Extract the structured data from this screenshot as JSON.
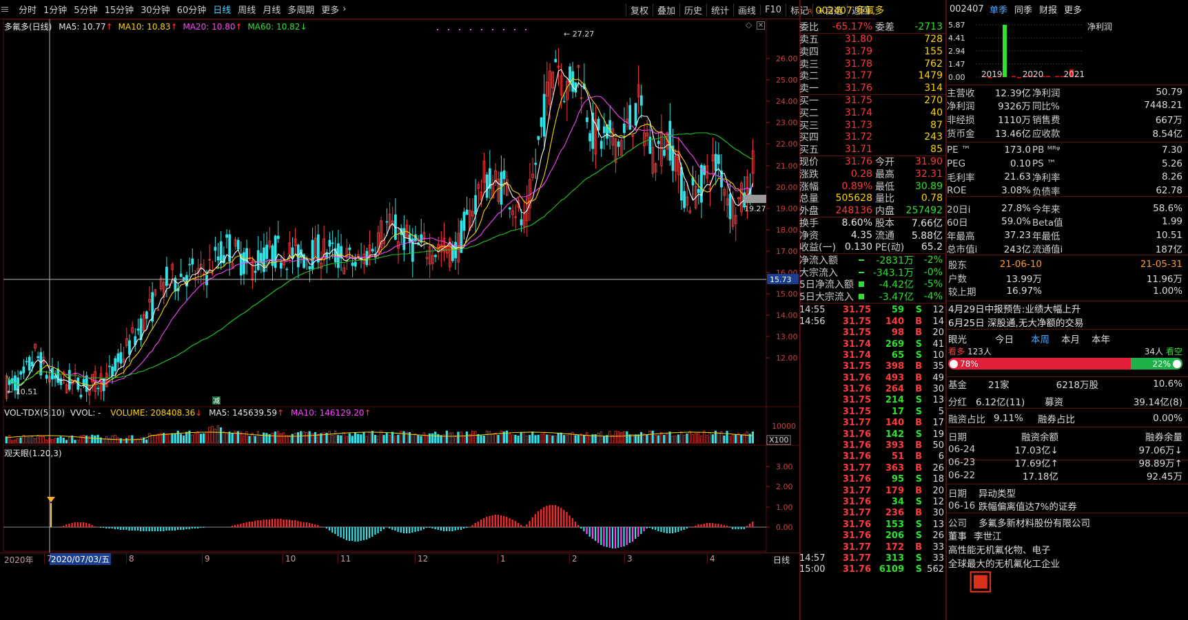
{
  "toolbar": {
    "periods": [
      "分时",
      "1分钟",
      "5分钟",
      "15分钟",
      "30分钟",
      "60分钟",
      "日线",
      "周线",
      "月线",
      "多周期",
      "更多"
    ],
    "active": "日线",
    "right": [
      "复权",
      "叠加",
      "历史",
      "统计",
      "画线",
      "F10",
      "标记",
      "+自选",
      "返回"
    ]
  },
  "main": {
    "title": "多氟多(日线)",
    "ma5": "MA5: 10.77",
    "ma10": "MA10: 10.83",
    "ma20": "MA20: 10.80",
    "ma60": "MA60: 10.82",
    "high_label": "27.27",
    "low_label": "10.51",
    "cur_label": "19.27",
    "cross_price": "15.73",
    "jian": "减",
    "yticks": [
      "26.00",
      "25.00",
      "24.00",
      "23.00",
      "22.00",
      "21.00",
      "20.00",
      "19.00",
      "18.00",
      "17.00",
      "16.00",
      "15.00",
      "14.00",
      "13.00",
      "12.00"
    ]
  },
  "vol": {
    "title": "VOL-TDX(5,10)",
    "vvol": "VVOL: -",
    "volume": "VOLUME: 208408.36",
    "ma5": "MA5: 145639.59",
    "ma10": "MA10: 146129.20",
    "ytick": "10000",
    "unit": "X100"
  },
  "ind": {
    "title": "观天眼(1.20,3)",
    "yticks": [
      "3.00",
      "2.00",
      "1.00",
      "0.00"
    ]
  },
  "timeaxis": {
    "year": "2020年",
    "cur": "2020/07/03/五",
    "months": [
      "7",
      "8",
      "9",
      "10",
      "11",
      "12",
      "1",
      "2",
      "3",
      "4"
    ],
    "right": "日线"
  },
  "quote": {
    "code": "002407",
    "name": "多氟多",
    "webi": {
      "label": "委比",
      "v1": "-65.17%",
      "l2": "委差",
      "v2": "-2713"
    },
    "sells": [
      {
        "l": "卖五",
        "p": "31.80",
        "v": "728"
      },
      {
        "l": "卖四",
        "p": "31.79",
        "v": "155"
      },
      {
        "l": "卖三",
        "p": "31.78",
        "v": "762"
      },
      {
        "l": "卖二",
        "p": "31.77",
        "v": "1479"
      },
      {
        "l": "卖一",
        "p": "31.76",
        "v": "314"
      }
    ],
    "buys": [
      {
        "l": "买一",
        "p": "31.75",
        "v": "270"
      },
      {
        "l": "买二",
        "p": "31.74",
        "v": "40"
      },
      {
        "l": "买三",
        "p": "31.73",
        "v": "87"
      },
      {
        "l": "买四",
        "p": "31.72",
        "v": "243"
      },
      {
        "l": "买五",
        "p": "31.71",
        "v": "85"
      }
    ],
    "stats": [
      [
        "现价",
        "31.76",
        "今开",
        "31.90"
      ],
      [
        "涨跌",
        "0.28",
        "最高",
        "32.31"
      ],
      [
        "涨幅",
        "0.89%",
        "最低",
        "30.89"
      ],
      [
        "总量",
        "505628",
        "量比",
        "0.78"
      ],
      [
        "外盘",
        "248136",
        "内盘",
        "257492"
      ]
    ],
    "stats2": [
      [
        "换手",
        "8.60%",
        "股本",
        "7.66亿"
      ],
      [
        "净资",
        "4.35",
        "流通",
        "5.88亿"
      ],
      [
        "收益(一)",
        "0.130",
        "PE(动)",
        "65.2"
      ]
    ],
    "flows": [
      [
        "净流入额",
        "-2831万",
        "-2%"
      ],
      [
        "大宗流入",
        "-343.1万",
        "-0%"
      ],
      [
        "5日净流入额",
        "-4.42亿",
        "-5%"
      ],
      [
        "5日大宗流入",
        "-3.47亿",
        "-4%"
      ]
    ],
    "ticks": [
      [
        "14:55",
        "31.75",
        "59",
        "S",
        "12"
      ],
      [
        "14:56",
        "31.75",
        "140",
        "B",
        "14"
      ],
      [
        "",
        "31.75",
        "98",
        "B",
        "20"
      ],
      [
        "",
        "31.74",
        "269",
        "S",
        "41"
      ],
      [
        "",
        "31.74",
        "65",
        "S",
        "10"
      ],
      [
        "",
        "31.75",
        "398",
        "B",
        "35"
      ],
      [
        "",
        "31.76",
        "493",
        "B",
        "49"
      ],
      [
        "",
        "31.76",
        "264",
        "B",
        "30"
      ],
      [
        "",
        "31.75",
        "214",
        "S",
        "13"
      ],
      [
        "",
        "31.75",
        "17",
        "S",
        "5"
      ],
      [
        "",
        "31.77",
        "140",
        "B",
        "17"
      ],
      [
        "",
        "31.76",
        "142",
        "S",
        "19"
      ],
      [
        "",
        "31.76",
        "393",
        "B",
        "50"
      ],
      [
        "",
        "31.76",
        "51",
        "B",
        "6"
      ],
      [
        "",
        "31.77",
        "363",
        "B",
        "26"
      ],
      [
        "",
        "31.76",
        "95",
        "S",
        "18"
      ],
      [
        "",
        "31.77",
        "179",
        "B",
        "20"
      ],
      [
        "",
        "31.76",
        "34",
        "S",
        "12"
      ],
      [
        "",
        "31.77",
        "236",
        "B",
        "30"
      ],
      [
        "",
        "31.76",
        "153",
        "S",
        "13"
      ],
      [
        "",
        "31.76",
        "206",
        "S",
        "26"
      ],
      [
        "",
        "31.77",
        "172",
        "B",
        "33"
      ],
      [
        "14:57",
        "31.77",
        "313",
        "S",
        "33"
      ],
      [
        "15:00",
        "31.76",
        "6109",
        "S",
        "562"
      ]
    ]
  },
  "fin": {
    "code": "002407",
    "tabs": [
      "单季",
      "同季",
      "财报",
      "更多"
    ],
    "netprofit": "净利润",
    "yaxis": [
      "5.87",
      "4.41",
      "2.94",
      "1.47",
      "0.00"
    ],
    "years": [
      "2019",
      "2020",
      "2021"
    ],
    "bars": [
      [
        0.02,
        -0.02
      ],
      [
        0.01,
        5.87
      ],
      [
        0.03,
        -0.01
      ],
      [
        0.07,
        0.09
      ],
      [
        0.02,
        0.03
      ],
      [
        0.05,
        0.03
      ],
      [
        0.85,
        0.0
      ]
    ],
    "rows": [
      [
        "主营收",
        "12.39亿",
        "净利润",
        "50.79"
      ],
      [
        "净利润",
        "9326万",
        "同比%",
        "7448.21"
      ],
      [
        "非经损",
        "1110万",
        "销售费",
        "667万"
      ],
      [
        "货币金",
        "13.46亿",
        "应收款",
        "8.54亿"
      ],
      [
        "PE ™",
        "173.0",
        "PB ᴹᴿᵠ",
        "7.30"
      ],
      [
        "PEG",
        "0.10",
        "PS ™",
        "5.26"
      ],
      [
        "毛利率",
        "21.63",
        "净利率",
        "8.26"
      ],
      [
        "ROE",
        "3.08%",
        "负债率",
        "62.78"
      ],
      [
        "20日i",
        "27.8%",
        "今年来",
        "58.6%"
      ],
      [
        "60日",
        "59.0%",
        "Beta值",
        "1.99"
      ],
      [
        "年最高",
        "37.23",
        "年最低",
        "10.51"
      ],
      [
        "总市值i",
        "243亿",
        "流通值i",
        "187亿"
      ]
    ],
    "holders": {
      "label": "股东",
      "d1": "21-06-10",
      "d2": "21-05-31",
      "rows": [
        [
          "户数",
          "13.99万",
          "11.96万"
        ],
        [
          "较上期",
          "16.97%",
          "1.00%"
        ]
      ]
    },
    "news": [
      "4月29日中报预告:业绩大幅上升",
      "6月25日 深股通,无大净额的交易"
    ],
    "eye": {
      "label": "眼光",
      "tabs": [
        "今日",
        "本周",
        "本月",
        "本年"
      ],
      "bull": "看多",
      "bull_n": "123人",
      "bear": "看空",
      "bear_n": "34人",
      "bull_pct": "78%",
      "bear_pct": "22%",
      "bull_frac": 0.78
    },
    "fund": [
      "基金",
      "21家",
      "6218万股",
      "10.6%"
    ],
    "split": [
      "分红",
      "6.12亿(11)",
      "募资",
      "39.14亿(8)"
    ],
    "margin": [
      "融资占比",
      "9.11%",
      "融券占比",
      "0.00%"
    ],
    "mhdr": [
      "日期",
      "融资余额",
      "融券余量"
    ],
    "mrows": [
      [
        "06-24",
        "17.03亿↓",
        "97.06万↓"
      ],
      [
        "06-23",
        "17.69亿↑",
        "98.89万↑"
      ],
      [
        "06-22",
        "17.18亿",
        "92.45万"
      ]
    ],
    "ahdr": [
      "日期",
      "异动类型"
    ],
    "arow": [
      "06-16",
      "跌幅偏离值达7%的证券"
    ],
    "company": [
      "公司",
      "多氟多新材料股份有限公司"
    ],
    "extra": [
      "董事",
      "李世江",
      "高性能无机氟化物、电子",
      "全球最大的无机氟化工企业"
    ]
  }
}
